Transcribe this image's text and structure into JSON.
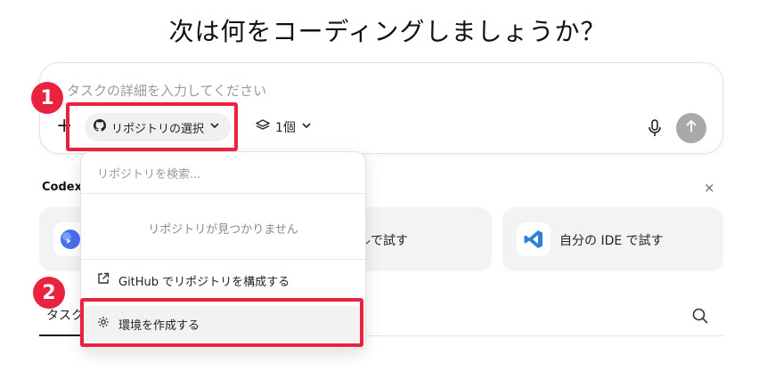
{
  "title": "次は何をコーディングしましょうか？",
  "composer": {
    "placeholder": "タスクの詳細を入力してください",
    "plus_label": "+",
    "repo_button_label": "リポジトリの選択",
    "count_label": "1個"
  },
  "codex_section": {
    "label": "Codex",
    "close_label": "×",
    "cards": [
      {
        "label": ""
      },
      {
        "label": "ナルで試す"
      },
      {
        "label": "自分の IDE で試す"
      }
    ]
  },
  "tasks": {
    "tab_label": "タスク"
  },
  "dropdown": {
    "search_placeholder": "リポジトリを検索...",
    "empty_message": "リポジトリが見つかりません",
    "items": [
      {
        "label": "GitHub でリポジトリを構成する",
        "icon": "external-link-icon"
      },
      {
        "label": "環境を作成する",
        "icon": "gear-icon"
      }
    ]
  },
  "annotations": {
    "badge1": "1",
    "badge2": "2",
    "highlight_color": "#e8223f"
  }
}
